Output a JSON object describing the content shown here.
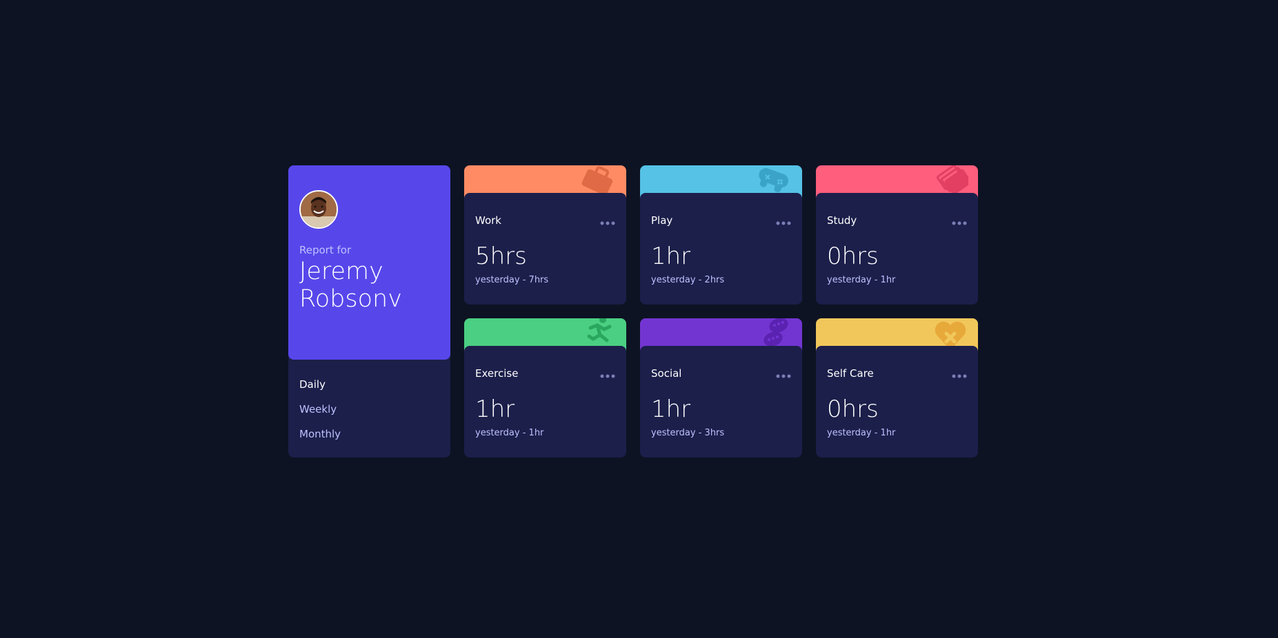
{
  "profile": {
    "report_for": "Report for",
    "name": "Jeremy Robsonv",
    "accent": "#5747ea",
    "timeframes": [
      "Daily",
      "Weekly",
      "Monthly"
    ],
    "active_timeframe": "Daily"
  },
  "activities": [
    {
      "title": "Work",
      "current": "5hrs",
      "previous": "yesterday - 7hrs",
      "color": "#ff8b64",
      "icon": "briefcase-icon"
    },
    {
      "title": "Play",
      "current": "1hr",
      "previous": "yesterday - 2hrs",
      "color": "#55c2e6",
      "icon": "gamepad-icon"
    },
    {
      "title": "Study",
      "current": "0hrs",
      "previous": "yesterday - 1hr",
      "color": "#ff5e7d",
      "icon": "book-icon"
    },
    {
      "title": "Exercise",
      "current": "1hr",
      "previous": "yesterday - 1hr",
      "color": "#4bcf82",
      "icon": "running-icon"
    },
    {
      "title": "Social",
      "current": "1hr",
      "previous": "yesterday - 3hrs",
      "color": "#7335d2",
      "icon": "chat-bubbles-icon"
    },
    {
      "title": "Self Care",
      "current": "0hrs",
      "previous": "yesterday - 1hr",
      "color": "#f1c75b",
      "icon": "heart-care-icon"
    }
  ]
}
